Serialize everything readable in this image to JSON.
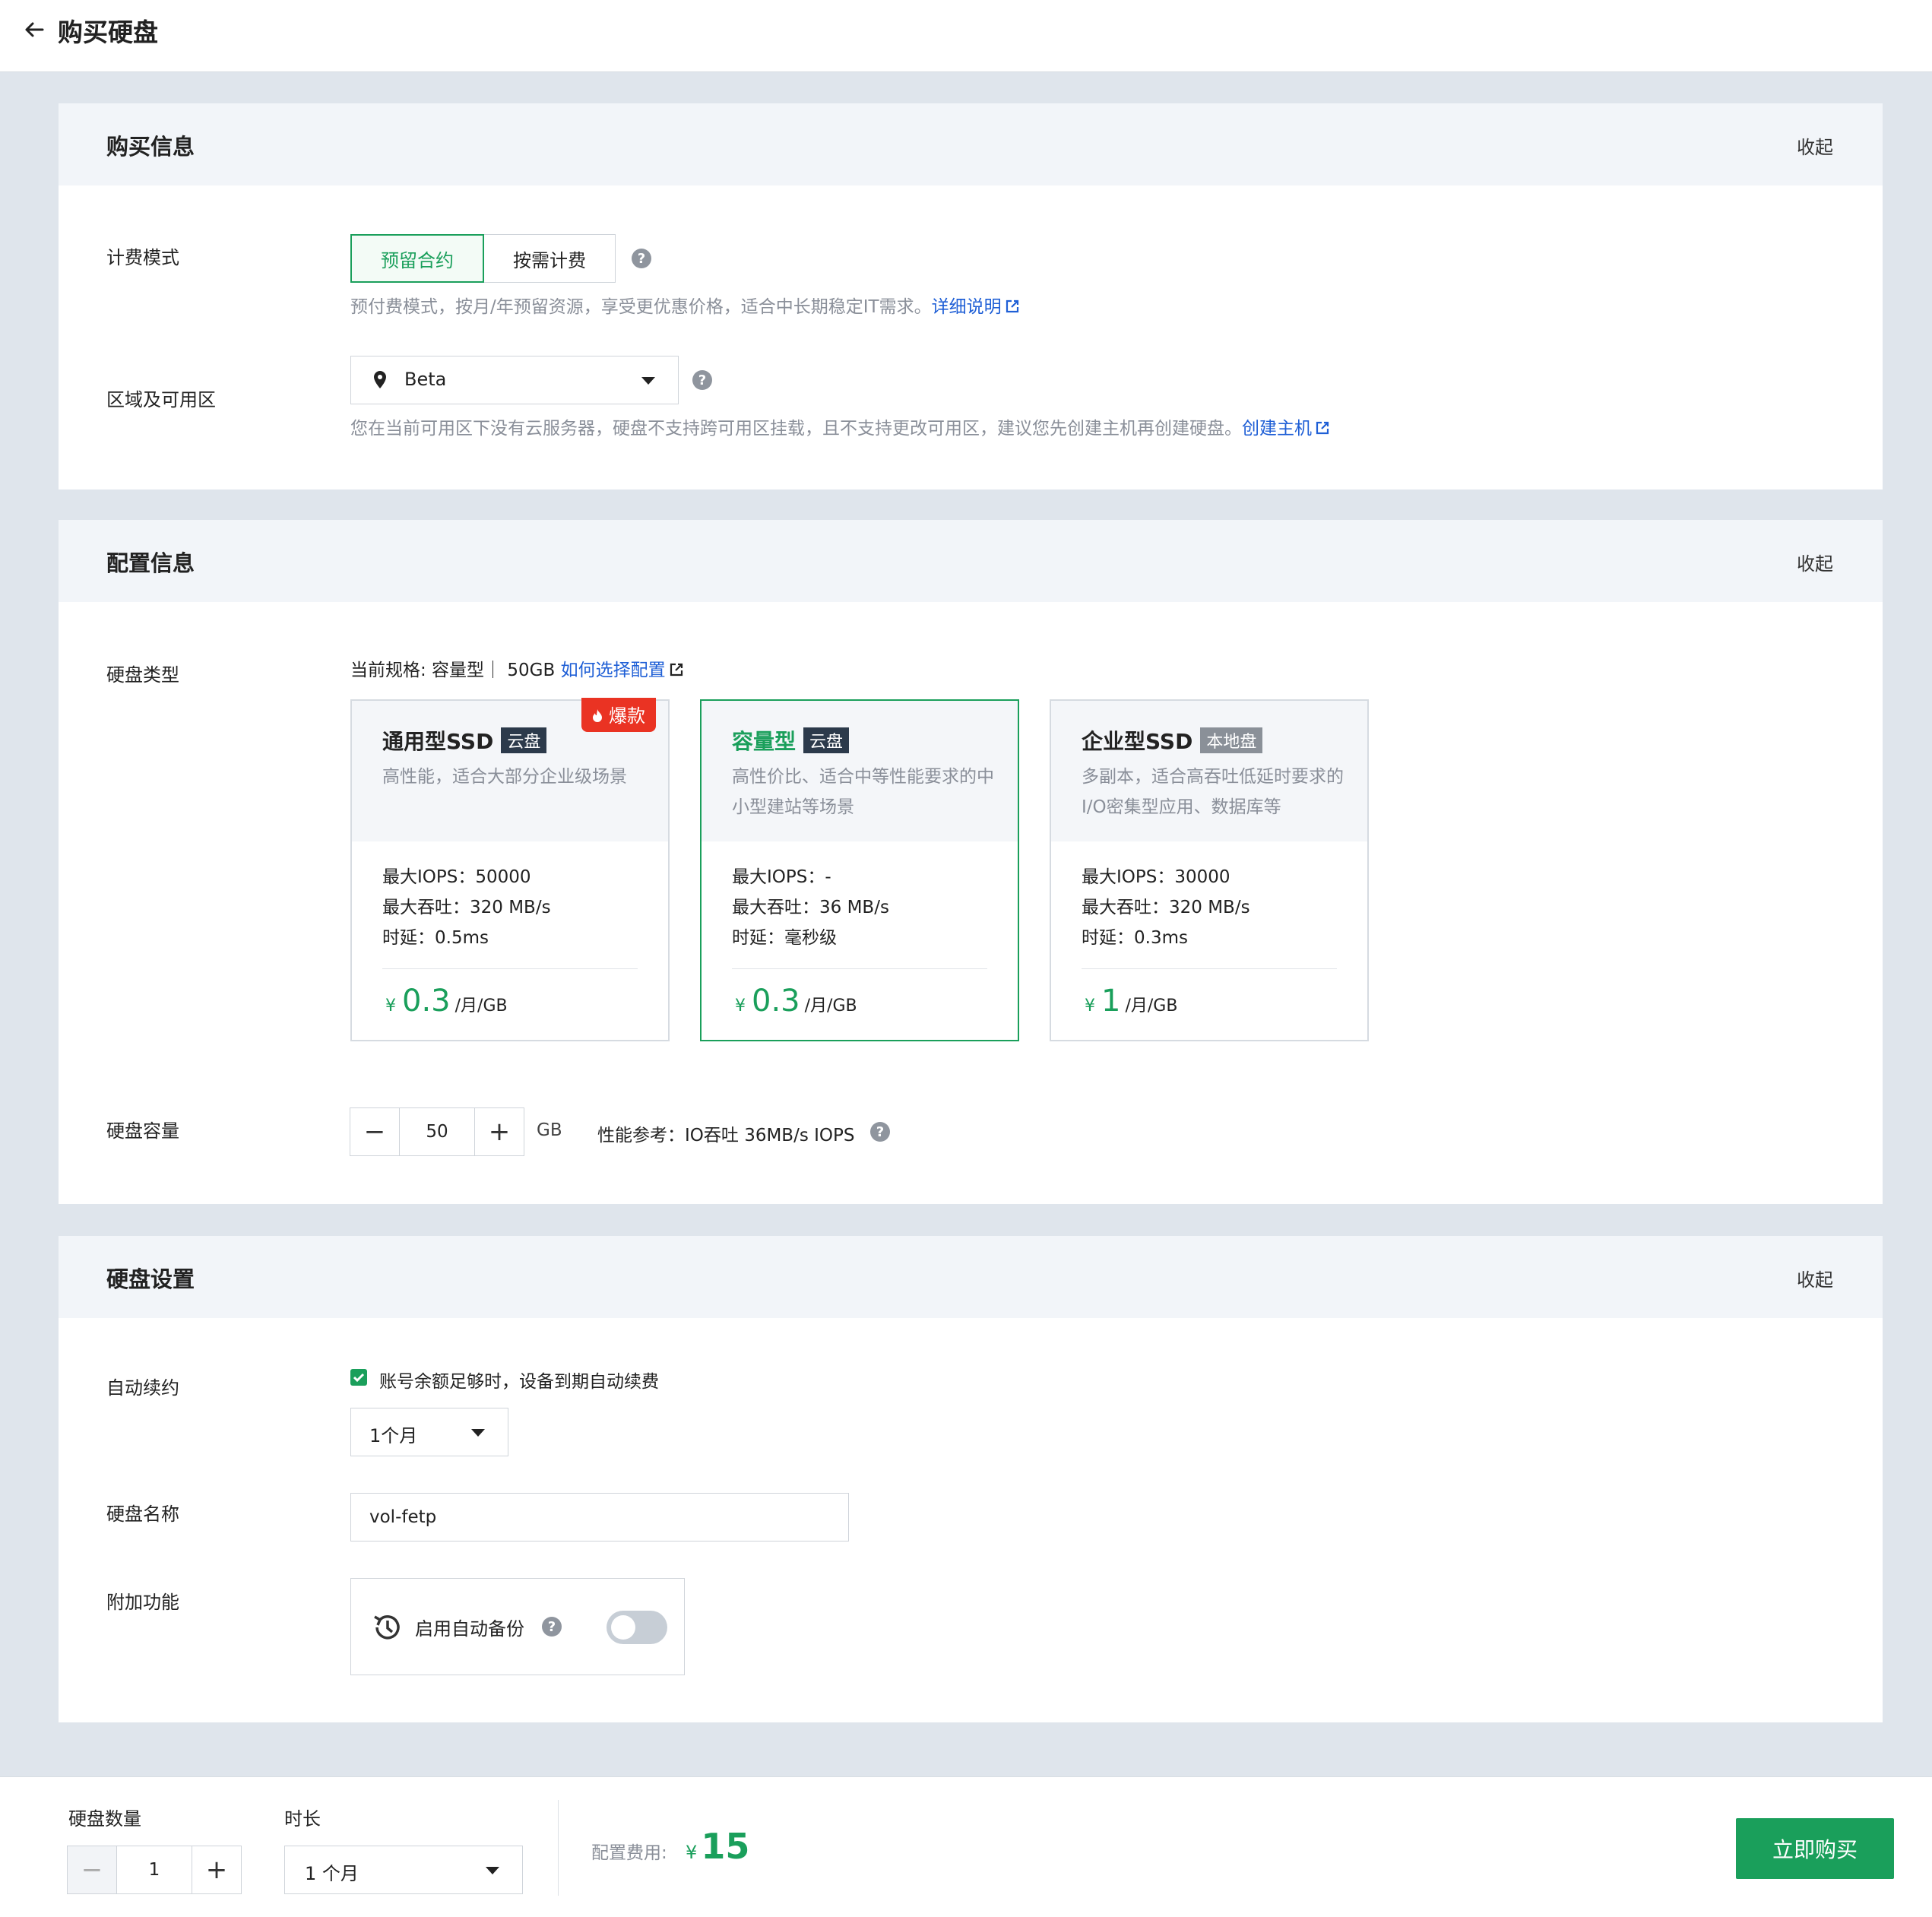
{
  "header": {
    "title": "购买硬盘"
  },
  "purchase": {
    "title": "购买信息",
    "collapse": "收起",
    "billing_label": "计费模式",
    "billing_options": [
      "预留合约",
      "按需计费"
    ],
    "billing_hint": "预付费模式，按月/年预留资源，享受更优惠价格，适合中长期稳定IT需求。",
    "billing_link": "详细说明",
    "region_label": "区域及可用区",
    "region_value": "Beta",
    "region_hint": "您在当前可用区下没有云服务器，硬盘不支持跨可用区挂载，且不支持更改可用区，建议您先创建主机再创建硬盘。",
    "region_link": "创建主机"
  },
  "config": {
    "title": "配置信息",
    "collapse": "收起",
    "disk_type_label": "硬盘类型",
    "current_spec": "当前规格: 容量型｜ 50GB",
    "spec_link": "如何选择配置",
    "disks": [
      {
        "name": "通用型SSD",
        "tag": "云盘",
        "badge": "爆款",
        "desc": "高性能，适合大部分企业级场景",
        "iops": "最大IOPS：50000",
        "throughput": "最大吞吐：320 MB/s",
        "latency": "时延：0.5ms",
        "currency": "¥",
        "price": "0.3",
        "unit": "/月/GB"
      },
      {
        "name": "容量型",
        "tag": "云盘",
        "desc": "高性价比、适合中等性能要求的中小型建站等场景",
        "iops": "最大IOPS：-",
        "throughput": "最大吞吐：36 MB/s",
        "latency": "时延：毫秒级",
        "currency": "¥",
        "price": "0.3",
        "unit": "/月/GB"
      },
      {
        "name": "企业型SSD",
        "tag": "本地盘",
        "desc": "多副本，适合高吞吐低延时要求的I/O密集型应用、数据库等",
        "iops": "最大IOPS：30000",
        "throughput": "最大吞吐：320 MB/s",
        "latency": "时延：0.3ms",
        "currency": "¥",
        "price": "1",
        "unit": "/月/GB"
      }
    ],
    "capacity_label": "硬盘容量",
    "capacity_value": "50",
    "capacity_unit": "GB",
    "perf_ref": "性能参考：IO吞吐 36MB/s IOPS"
  },
  "settings": {
    "title": "硬盘设置",
    "collapse": "收起",
    "auto_renew_label": "自动续约",
    "auto_renew_text": "账号余额足够时，设备到期自动续费",
    "auto_renew_period": "1个月",
    "name_label": "硬盘名称",
    "name_value": "vol-fetp",
    "addon_label": "附加功能",
    "backup_text": "启用自动备份"
  },
  "footer": {
    "qty_label": "硬盘数量",
    "qty_value": "1",
    "duration_label": "时长",
    "duration_value": "1 个月",
    "fee_label": "配置费用:",
    "fee_currency": "¥",
    "fee_value": "15",
    "buy_label": "立即购买"
  },
  "colors": {
    "accent": "#1a9f5b",
    "link": "#1f5fd6",
    "hot": "#ea3323"
  }
}
